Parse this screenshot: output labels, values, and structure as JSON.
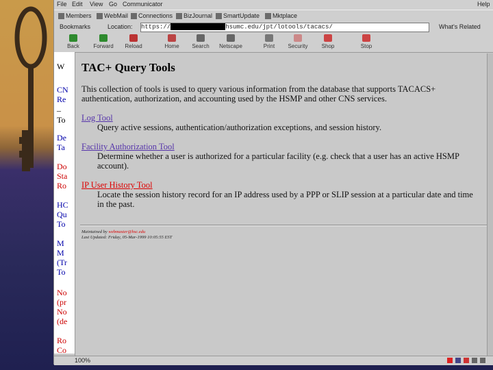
{
  "menu": {
    "items": [
      "File",
      "Edit",
      "View",
      "Go",
      "Communicator"
    ],
    "help": "Help"
  },
  "personal_toolbar": [
    "Members",
    "WebMail",
    "Connections",
    "BizJournal",
    "SmartUpdate",
    "Mktplace"
  ],
  "location_bar": {
    "bookmarks": "Bookmarks",
    "location_label": "Location:",
    "url_prefix": "https://",
    "url_suffix": "hsumc.edu/jpt/lotools/tacacs/",
    "whats_related": "What's Related"
  },
  "toolbar": [
    "Back",
    "Forward",
    "Reload",
    "Home",
    "Search",
    "Netscape",
    "Print",
    "Security",
    "Shop",
    "Stop"
  ],
  "left_page_fragments": [
    {
      "text": "W",
      "color": "#000"
    },
    {
      "text": "CN",
      "color": "#0000aa"
    },
    {
      "text": "Re",
      "color": "#0000aa"
    },
    {
      "text": "–",
      "color": "#000"
    },
    {
      "text": "To",
      "color": "#000"
    },
    {
      "text": "De",
      "color": "#0000aa"
    },
    {
      "text": "Ta",
      "color": "#0000aa"
    },
    {
      "text": "Do",
      "color": "#cc0000"
    },
    {
      "text": "Sta",
      "color": "#cc0000"
    },
    {
      "text": "Ro",
      "color": "#cc0000"
    },
    {
      "text": "HC",
      "color": "#0000aa"
    },
    {
      "text": "Qu",
      "color": "#0000aa"
    },
    {
      "text": "To",
      "color": "#0000aa"
    },
    {
      "text": "M",
      "color": "#0000aa"
    },
    {
      "text": "M",
      "color": "#0000aa"
    },
    {
      "text": "(Tr",
      "color": "#0000aa"
    },
    {
      "text": "To",
      "color": "#0000aa"
    },
    {
      "text": "No",
      "color": "#cc0000"
    },
    {
      "text": "(pr",
      "color": "#cc0000"
    },
    {
      "text": "No",
      "color": "#cc0000"
    },
    {
      "text": "(de",
      "color": "#cc0000"
    },
    {
      "text": "Ro",
      "color": "#cc0000"
    },
    {
      "text": "Co",
      "color": "#cc0000"
    }
  ],
  "page": {
    "title": "TAC+ Query Tools",
    "intro": "This collection of tools is used to query various information from the database that supports TACACS+ authentication, authorization, and accounting used by the HSMP and other CNS services.",
    "tools": [
      {
        "label": "Log Tool",
        "color": "#5533aa",
        "description": "Query active sessions, authentication/authorization exceptions, and session history."
      },
      {
        "label": "Facility Authorization Tool",
        "color": "#5533aa",
        "description": "Determine whether a user is authorized for a particular facility (e.g. check that a user has an active HSMP account)."
      },
      {
        "label": "IP User History Tool",
        "color": "#dd0000",
        "description": "Locate the session history record for an IP address used by a PPP or SLIP session at a particular date and time in the past."
      }
    ],
    "footer_maintained": "Maintained by ",
    "footer_email": "webmaster@hsc.edu",
    "footer_modified": "Last Updated: Friday, 05-Mar-1999 10:05:55 EST"
  },
  "status": {
    "text": "100%"
  }
}
